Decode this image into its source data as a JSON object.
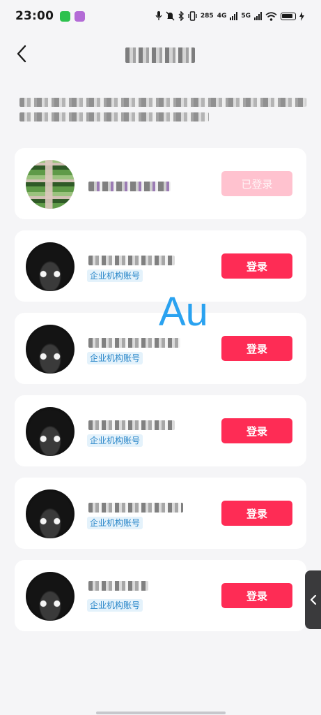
{
  "status_bar": {
    "time": "23:00",
    "net_speed": "285",
    "net_4g": "4G",
    "net_5g": "5G",
    "icons": [
      "wechat-icon",
      "app-badge-icon",
      "mic-icon",
      "mute-icon",
      "bluetooth-icon",
      "vibrate-icon",
      "signal-icon",
      "wifi-icon",
      "battery-icon",
      "charging-icon"
    ]
  },
  "nav": {
    "title": "",
    "back_icon": "chevron-left-icon"
  },
  "description": "",
  "accounts": [
    {
      "name": "",
      "tag": "",
      "button": "已登录",
      "state": "logged-in"
    },
    {
      "name": "",
      "tag": "企业机构账号",
      "button": "登录",
      "state": "login"
    },
    {
      "name": "",
      "tag": "企业机构账号",
      "button": "登录",
      "state": "login"
    },
    {
      "name": "",
      "tag": "企业机构账号",
      "button": "登录",
      "state": "login"
    },
    {
      "name": "",
      "tag": "企业机构账号",
      "button": "登录",
      "state": "login"
    },
    {
      "name": "",
      "tag": "企业机构账号",
      "button": "登录",
      "state": "login"
    }
  ],
  "watermark": "Au",
  "colors": {
    "accent": "#fe2c55",
    "accent_disabled": "#ffc2cf",
    "tag_bg": "#e4f2fb",
    "tag_text": "#2785c8",
    "page_bg": "#f5f5f7",
    "watermark": "#2aa2f0"
  }
}
